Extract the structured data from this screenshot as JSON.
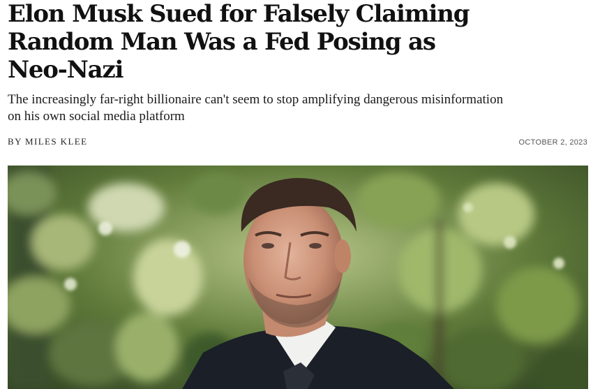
{
  "article": {
    "headline": "Elon Musk Sued for Falsely Claiming Random Man Was a Fed Posing as Neo-Nazi",
    "dek": "The increasingly far-right billionaire can't seem to stop amplifying dangerous misinformation on his own social media platform",
    "byline": "BY MILES KLEE",
    "date": "OCTOBER 2, 2023"
  },
  "hero_image": {
    "subject": "man-in-suit-photo"
  }
}
